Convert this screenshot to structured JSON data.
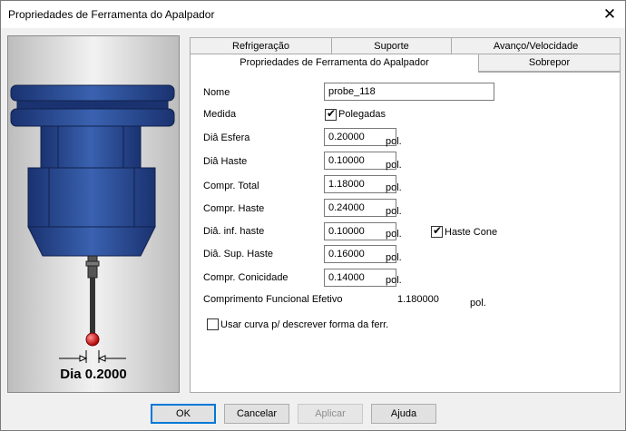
{
  "window": {
    "title": "Propriedades de Ferramenta do Apalpador",
    "close_glyph": "✕"
  },
  "preview": {
    "dia_label": "Dia 0.2000"
  },
  "tabs": {
    "refrigeracao": "Refrigeração",
    "suporte": "Suporte",
    "avanco": "Avanço/Velocidade",
    "propriedades": "Propriedades de Ferramenta do Apalpador",
    "sobrepor": "Sobrepor"
  },
  "form": {
    "nome_label": "Nome",
    "nome_value": "probe_118",
    "medida_label": "Medida",
    "polegadas_label": "Polegadas",
    "polegadas_checked": true,
    "unit": "pol.",
    "dia_esfera_label": "Diâ Esfera",
    "dia_esfera_value": "0.20000",
    "dia_haste_label": "Diâ Haste",
    "dia_haste_value": "0.10000",
    "compr_total_label": "Compr. Total",
    "compr_total_value": "1.18000",
    "compr_haste_label": "Compr. Haste",
    "compr_haste_value": "0.24000",
    "dia_inf_haste_label": "Diâ. inf. haste",
    "dia_inf_haste_value": "0.10000",
    "haste_cone_label": "Haste Cone",
    "haste_cone_checked": true,
    "dia_sup_haste_label": "Diâ. Sup. Haste",
    "dia_sup_haste_value": "0.16000",
    "compr_conicidade_label": "Compr. Conicidade",
    "compr_conicidade_value": "0.14000",
    "comprimento_funcional_label": "Comprimento Funcional Efetivo",
    "comprimento_funcional_value": "1.180000",
    "usar_curva_label": "Usar curva p/ descrever forma da ferr.",
    "usar_curva_checked": false
  },
  "buttons": {
    "ok": "OK",
    "cancelar": "Cancelar",
    "aplicar": "Aplicar",
    "ajuda": "Ajuda"
  },
  "colors": {
    "probe_body": "#2a4a8c",
    "probe_ball": "#d01818",
    "default_button_border": "#0078d7"
  }
}
